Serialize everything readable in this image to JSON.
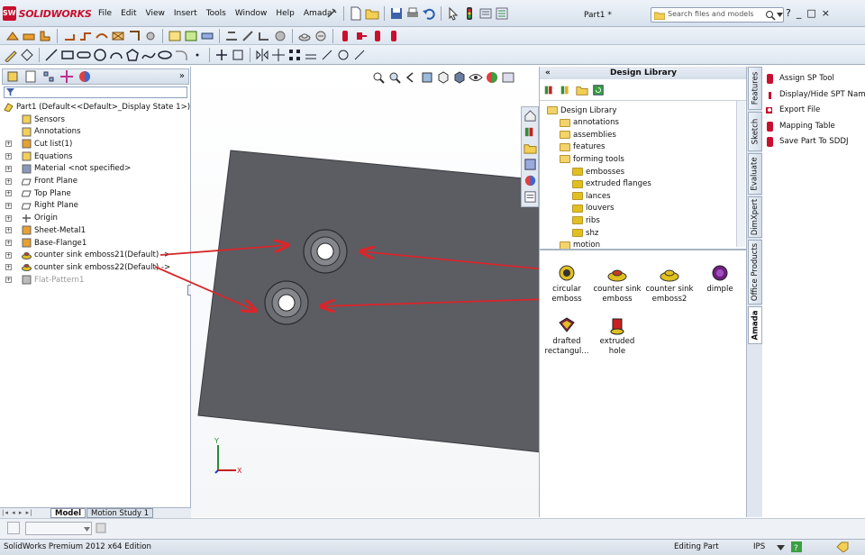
{
  "app": {
    "logo_text": "SOLIDWORKS",
    "logo_badge": "SW",
    "doc_title": "Part1 *"
  },
  "menu": [
    "File",
    "Edit",
    "View",
    "Insert",
    "Tools",
    "Window",
    "Help",
    "Amada"
  ],
  "search": {
    "placeholder": "Search files and models"
  },
  "window_buttons": [
    "?",
    "_",
    "□",
    "×"
  ],
  "feature_tree": {
    "root": "Part1  (Default<<Default>_Display State 1>)",
    "items": [
      {
        "label": "Sensors",
        "icon": "sensor-icon"
      },
      {
        "label": "Annotations",
        "icon": "annotation-icon"
      },
      {
        "label": "Cut list(1)",
        "icon": "cutlist-icon"
      },
      {
        "label": "Equations",
        "icon": "equation-icon"
      },
      {
        "label": "Material <not specified>",
        "icon": "material-icon"
      },
      {
        "label": "Front Plane",
        "icon": "plane-icon"
      },
      {
        "label": "Top Plane",
        "icon": "plane-icon"
      },
      {
        "label": "Right Plane",
        "icon": "plane-icon"
      },
      {
        "label": "Origin",
        "icon": "origin-icon"
      },
      {
        "label": "Sheet-Metal1",
        "icon": "sheetmetal-icon"
      },
      {
        "label": "Base-Flange1",
        "icon": "flange-icon"
      },
      {
        "label": "counter sink emboss21(Default) ->",
        "icon": "forming-tool-icon"
      },
      {
        "label": "counter sink emboss22(Default) ->",
        "icon": "forming-tool-icon"
      },
      {
        "label": "Flat-Pattern1",
        "icon": "flat-pattern-icon",
        "grayed": true
      }
    ]
  },
  "design_library": {
    "title": "Design Library",
    "tree": [
      {
        "label": "Design Library",
        "level": 0
      },
      {
        "label": "annotations",
        "level": 1
      },
      {
        "label": "assemblies",
        "level": 1
      },
      {
        "label": "features",
        "level": 1
      },
      {
        "label": "forming tools",
        "level": 1
      },
      {
        "label": "embosses",
        "level": 2
      },
      {
        "label": "extruded flanges",
        "level": 2
      },
      {
        "label": "lances",
        "level": 2
      },
      {
        "label": "louvers",
        "level": 2
      },
      {
        "label": "ribs",
        "level": 2
      },
      {
        "label": "shz",
        "level": 2
      },
      {
        "label": "motion",
        "level": 1
      }
    ],
    "items": [
      {
        "line1": "circular",
        "line2": "emboss"
      },
      {
        "line1": "counter sink",
        "line2": "emboss"
      },
      {
        "line1": "counter sink",
        "line2": "emboss2"
      },
      {
        "line1": "dimple",
        "line2": ""
      },
      {
        "line1": "drafted",
        "line2": "rectangul..."
      },
      {
        "line1": "extruded",
        "line2": "hole"
      }
    ]
  },
  "side_tabs": [
    "Features",
    "Sketch",
    "Evaluate",
    "DimXpert",
    "Office Products",
    "Amada"
  ],
  "amada_panel": [
    "Assign SP Tool",
    "Display/Hide SPT Name",
    "Export File",
    "Mapping Table",
    "Save Part To SDDJ"
  ],
  "bottom_tabs": [
    "Model",
    "Motion Study 1"
  ],
  "status": {
    "edition": "SolidWorks Premium 2012 x64 Edition",
    "mode": "Editing Part",
    "units": "IPS"
  },
  "axes": {
    "x": "X",
    "y": "Y"
  },
  "colors": {
    "plate": "#5b5d63",
    "arrow": "#d8262a",
    "accent_red": "#c8102e"
  }
}
